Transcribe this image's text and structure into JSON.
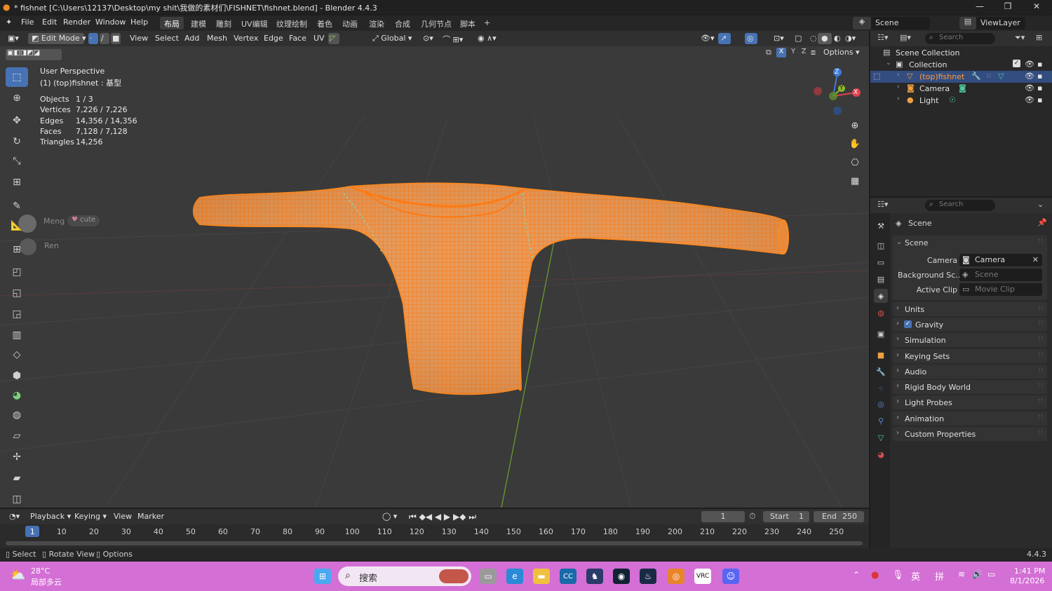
{
  "window": {
    "title": "* fishnet [C:\\Users\\12137\\Desktop\\my shit\\我做的素材们\\FISHNET\\fishnet.blend] - Blender 4.4.3",
    "minimize": "—",
    "maximize": "❐",
    "close": "✕"
  },
  "menu": {
    "items": [
      "File",
      "Edit",
      "Render",
      "Window",
      "Help"
    ],
    "workspaces": [
      "布局",
      "建模",
      "雕刻",
      "UV编辑",
      "纹理绘制",
      "着色",
      "动画",
      "渲染",
      "合成",
      "几何节点",
      "脚本"
    ],
    "add_workspace": "+",
    "scene_label": "Scene",
    "viewlayer_label": "ViewLayer"
  },
  "viewport_header": {
    "mode": "Edit Mode",
    "menus": [
      "View",
      "Select",
      "Add",
      "Mesh",
      "Vertex",
      "Edge",
      "Face",
      "UV"
    ],
    "transform_orientation": "Global",
    "options_label": "Options",
    "axis_labels": [
      "X",
      "Y",
      "Z"
    ]
  },
  "viewport": {
    "perspective": "User Perspective",
    "object_name": "(1) (top)fishnet : 基型",
    "stats": [
      {
        "label": "Objects",
        "value": "1 / 3"
      },
      {
        "label": "Vertices",
        "value": "7,226 / 7,226"
      },
      {
        "label": "Edges",
        "value": "14,356 / 14,356"
      },
      {
        "label": "Faces",
        "value": "7,128 / 7,128"
      },
      {
        "label": "Triangles",
        "value": "14,256"
      }
    ],
    "overlay_names": [
      "Meng",
      "cute",
      "Ren"
    ],
    "gizmo_axes": [
      "Z",
      "Y",
      "X"
    ]
  },
  "timeline": {
    "menus": [
      "Playback",
      "Keying",
      "View",
      "Marker"
    ],
    "current_frame": "1",
    "start_label": "Start",
    "start": "1",
    "end_label": "End",
    "end": "250",
    "ruler": [
      "1",
      "10",
      "20",
      "30",
      "40",
      "50",
      "60",
      "70",
      "80",
      "90",
      "100",
      "110",
      "120",
      "130",
      "140",
      "150",
      "160",
      "170",
      "180",
      "190",
      "200",
      "210",
      "220",
      "230",
      "240",
      "250"
    ]
  },
  "statusbar": {
    "items": [
      "Select",
      "Rotate View",
      "Options"
    ],
    "version": "4.4.3"
  },
  "outliner": {
    "search_placeholder": "Search",
    "scene_collection": "Scene Collection",
    "collection": "Collection",
    "objects": [
      "(top)fishnet",
      "Camera",
      "Light"
    ]
  },
  "properties": {
    "search_placeholder": "Search",
    "header": "Scene",
    "panel_title": "Scene",
    "camera_label": "Camera",
    "camera_value": "Camera",
    "background_label": "Background Sc...",
    "background_value": "Scene",
    "active_clip_label": "Active Clip",
    "active_clip_value": "Movie Clip",
    "panels": [
      "Units",
      "Gravity",
      "Simulation",
      "Keying Sets",
      "Audio",
      "Rigid Body World",
      "Light Probes",
      "Animation",
      "Custom Properties"
    ]
  },
  "taskbar": {
    "weather_temp": "28°C",
    "weather_desc": "局部多云",
    "search_placeholder": "搜索",
    "lang_1": "英",
    "lang_2": "拼",
    "time": "1:41 PM",
    "date": "8/1/2026"
  },
  "colors": {
    "accent": "#4772b3",
    "mesh_orange": "#ff8a1f",
    "taskbar": "#d36fd5",
    "axis_x": "#e2424e",
    "axis_y": "#8bbb2c",
    "axis_z": "#3f7ad6"
  }
}
